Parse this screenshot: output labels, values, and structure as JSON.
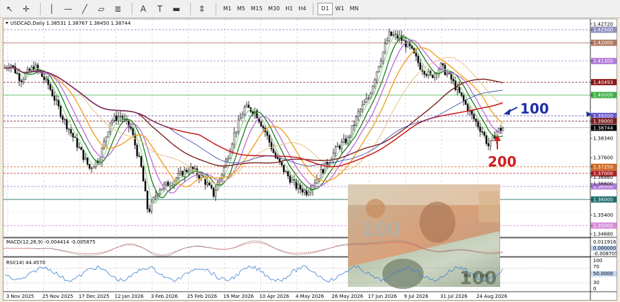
{
  "toolbar": {
    "tools": [
      {
        "name": "cursor-icon",
        "glyph": "↖"
      },
      {
        "name": "crosshair-icon",
        "glyph": "✛"
      },
      {
        "name": "vertical-line-icon",
        "glyph": "│"
      },
      {
        "name": "horizontal-line-icon",
        "glyph": "—"
      },
      {
        "name": "trendline-icon",
        "glyph": "╱"
      },
      {
        "name": "equidistant-channel-icon",
        "glyph": "▱"
      },
      {
        "name": "fibonacci-icon",
        "glyph": "≣"
      },
      {
        "name": "text-icon",
        "glyph": "A"
      },
      {
        "name": "text-label-icon",
        "glyph": "T"
      },
      {
        "name": "rectangle-icon",
        "glyph": "▬"
      },
      {
        "name": "arrows-icon",
        "glyph": "⇕"
      }
    ],
    "timeframes": [
      "M1",
      "M5",
      "M15",
      "M30",
      "H1",
      "H4",
      "D1",
      "W1",
      "MN"
    ],
    "active_timeframe": "D1"
  },
  "chart": {
    "header": "USDCAD,Daily  1.38531 1.38767 1.38450 1.38744",
    "current_price": "1.38744",
    "price_labels": [
      {
        "value": "1.42720",
        "style": "plain"
      },
      {
        "value": "1.42500",
        "style": "tag",
        "color": "#8f8fbf"
      },
      {
        "value": "1.42000",
        "style": "tag",
        "color": "#b07860"
      },
      {
        "value": "1.41300",
        "style": "tag",
        "color": "#b07ad9"
      },
      {
        "value": "1.40493",
        "style": "tag",
        "color": "#8b1a1a"
      },
      {
        "value": "1.40000",
        "style": "tag",
        "color": "#3cb043"
      },
      {
        "value": "1.39200",
        "style": "tag",
        "color": "#6a5acd"
      },
      {
        "value": "1.39000",
        "style": "tag",
        "color": "#7a1f1f"
      },
      {
        "value": "1.38744",
        "style": "tag",
        "color": "#000000"
      },
      {
        "value": "1.38340",
        "style": "plain"
      },
      {
        "value": "1.37600",
        "style": "plain"
      },
      {
        "value": "1.37250",
        "style": "tag",
        "color": "#d2691e"
      },
      {
        "value": "1.37000",
        "style": "tag",
        "color": "#b22222"
      },
      {
        "value": "1.36860",
        "style": "plain"
      },
      {
        "value": "1.36500",
        "style": "tag",
        "color": "#b07ad9"
      },
      {
        "value": "1.36600",
        "style": "plain"
      },
      {
        "value": "1.36000",
        "style": "tag",
        "color": "#1e6e6e"
      },
      {
        "value": "1.35400",
        "style": "plain"
      },
      {
        "value": "1.35000",
        "style": "tag",
        "color": "#d98ad9"
      },
      {
        "value": "1.34680",
        "style": "plain"
      }
    ],
    "annotations": {
      "ma100": "100",
      "ma200": "200"
    },
    "dates": [
      "3 Nov 2025",
      "25 Nov 2025",
      "17 Dec 2025",
      "12 Jan 2026",
      "3 Feb 2026",
      "25 Feb 2026",
      "19 Mar 2026",
      "10 Apr 2026",
      "4 May 2026",
      "26 May 2026",
      "17 Jun 2026",
      "9 Jul 2026",
      "31 Jul 2026",
      "24 Aug 2026"
    ]
  },
  "macd": {
    "label": "MACD(12,26,9) -0.004414 -0.005875",
    "scale": [
      "0.011916",
      "0.000000",
      "-0.008705"
    ]
  },
  "rsi": {
    "label": "RSI(14) 44.4570",
    "scale": [
      "100",
      "70",
      "50.0000",
      "30",
      "0"
    ]
  },
  "photo": {
    "bill_cad": "100",
    "bill_usd": "100",
    "serial": "MB 97186"
  }
}
